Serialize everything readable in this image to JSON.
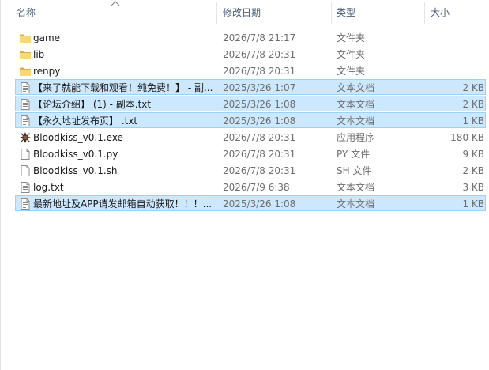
{
  "columns": {
    "name": "名称",
    "date": "修改日期",
    "type": "类型",
    "size": "大小"
  },
  "files": [
    {
      "name": "game",
      "date": "2026/7/8 21:17",
      "type": "文件夹",
      "size": "",
      "icon": "folder-icon",
      "selected": false
    },
    {
      "name": "lib",
      "date": "2026/7/8 20:31",
      "type": "文件夹",
      "size": "",
      "icon": "folder-icon",
      "selected": false
    },
    {
      "name": "renpy",
      "date": "2026/7/8 20:31",
      "type": "文件夹",
      "size": "",
      "icon": "folder-icon",
      "selected": false
    },
    {
      "name": "【来了就能下载和观看！纯免费！】 - 副...",
      "date": "2025/3/26 1:07",
      "type": "文本文档",
      "size": "2 KB",
      "icon": "text-file-icon",
      "selected": true
    },
    {
      "name": "【论坛介绍】 (1) - 副本.txt",
      "date": "2025/3/26 1:08",
      "type": "文本文档",
      "size": "2 KB",
      "icon": "text-file-icon",
      "selected": true
    },
    {
      "name": "【永久地址发布页】 .txt",
      "date": "2025/3/26 1:08",
      "type": "文本文档",
      "size": "1 KB",
      "icon": "text-file-icon",
      "selected": true
    },
    {
      "name": "Bloodkiss_v0.1.exe",
      "date": "2026/7/8 20:31",
      "type": "应用程序",
      "size": "180 KB",
      "icon": "app-exe-icon",
      "selected": false
    },
    {
      "name": "Bloodkiss_v0.1.py",
      "date": "2026/7/8 20:31",
      "type": "PY 文件",
      "size": "9 KB",
      "icon": "blank-file-icon",
      "selected": false
    },
    {
      "name": "Bloodkiss_v0.1.sh",
      "date": "2026/7/8 20:31",
      "type": "SH 文件",
      "size": "2 KB",
      "icon": "blank-file-icon",
      "selected": false
    },
    {
      "name": "log.txt",
      "date": "2026/7/9 6:38",
      "type": "文本文档",
      "size": "3 KB",
      "icon": "text-file-icon",
      "selected": false
    },
    {
      "name": "最新地址及APP请发邮箱自动获取！！！...",
      "date": "2025/3/26 1:08",
      "type": "文本文档",
      "size": "1 KB",
      "icon": "text-file-icon",
      "selected": true
    }
  ]
}
